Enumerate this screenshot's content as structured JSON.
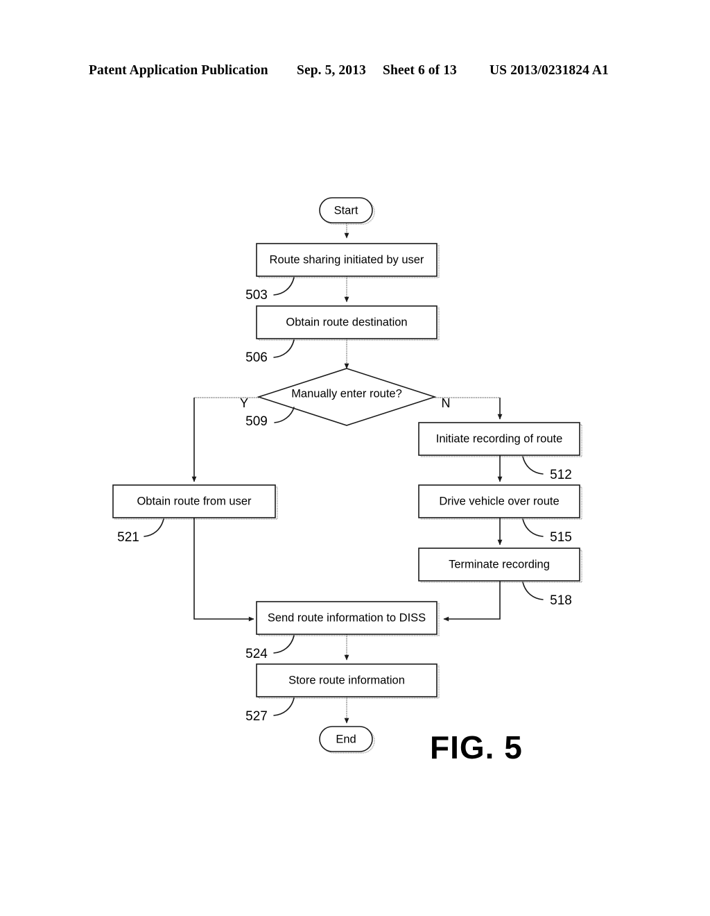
{
  "header": {
    "publication": "Patent Application Publication",
    "date": "Sep. 5, 2013",
    "sheet": "Sheet 6 of 13",
    "patent_number": "US 2013/0231824 A1"
  },
  "figure": {
    "label": "FIG. 5",
    "nodes": {
      "start": "Start",
      "route_sharing": "Route sharing initiated by user",
      "obtain_destination": "Obtain route destination",
      "decision": "Manually enter route?",
      "initiate_recording": "Initiate recording of route",
      "drive_vehicle": "Drive vehicle over route",
      "terminate_recording": "Terminate recording",
      "obtain_route_user": "Obtain route from user",
      "send_diss": "Send route information to DISS",
      "store_info": "Store route information",
      "end": "End"
    },
    "branch_labels": {
      "yes": "Y",
      "no": "N"
    },
    "reference_numerals": {
      "route_sharing": "503",
      "obtain_destination": "506",
      "decision": "509",
      "initiate_recording": "512",
      "drive_vehicle": "515",
      "terminate_recording": "518",
      "obtain_route_user": "521",
      "send_diss": "524",
      "store_info": "527"
    }
  },
  "colors": {
    "ink": "#1a1a1a",
    "paper": "#ffffff",
    "shadow": "#9a9a9a"
  }
}
